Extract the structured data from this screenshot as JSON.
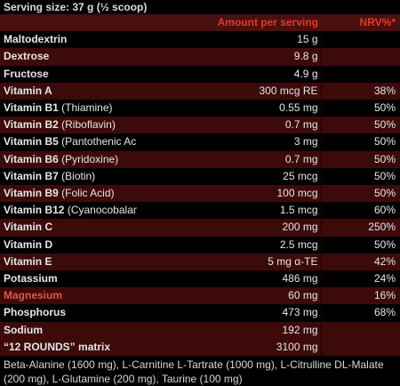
{
  "serving": "Serving size: 37 g (½ scoop)",
  "headers": {
    "name": "",
    "amount": "Amount per serving",
    "nrv": "NRV%*"
  },
  "rows": [
    {
      "name": "Maltodextrin",
      "sub": "",
      "amount": "15 g",
      "nrv": "",
      "style": "dark",
      "accent": false
    },
    {
      "name": "Dextrose",
      "sub": "",
      "amount": "9.8 g",
      "nrv": "",
      "style": "red",
      "accent": false
    },
    {
      "name": "Fructose",
      "sub": "",
      "amount": "4.9 g",
      "nrv": "",
      "style": "dark",
      "accent": false
    },
    {
      "name": "Vitamin A",
      "sub": "",
      "amount": "300 mcg RE",
      "nrv": "38%",
      "style": "red",
      "accent": false
    },
    {
      "name": "Vitamin B1",
      "sub": " (Thiamine)",
      "amount": "0.55 mg",
      "nrv": "50%",
      "style": "dark",
      "accent": false
    },
    {
      "name": "Vitamin B2",
      "sub": " (Riboflavin)",
      "amount": "0.7 mg",
      "nrv": "50%",
      "style": "red",
      "accent": false
    },
    {
      "name": "Vitamin B5",
      "sub": " (Pantothenic Acid)",
      "amount": "3 mg",
      "nrv": "50%",
      "style": "dark",
      "accent": false
    },
    {
      "name": "Vitamin B6",
      "sub": " (Pyridoxine)",
      "amount": "0.7 mg",
      "nrv": "50%",
      "style": "red",
      "accent": false
    },
    {
      "name": "Vitamin B7",
      "sub": " (Biotin)",
      "amount": "25 mcg",
      "nrv": "50%",
      "style": "dark",
      "accent": false
    },
    {
      "name": "Vitamin B9",
      "sub": " (Folic Acid)",
      "amount": "100 mcg",
      "nrv": "50%",
      "style": "red",
      "accent": false
    },
    {
      "name": "Vitamin B12",
      "sub": " (Cyanocobalamin)",
      "amount": "1.5 mcg",
      "nrv": "60%",
      "style": "dark",
      "accent": false
    },
    {
      "name": "Vitamin C",
      "sub": "",
      "amount": "200 mg",
      "nrv": "250%",
      "style": "red",
      "accent": false
    },
    {
      "name": "Vitamin D",
      "sub": "",
      "amount": "2.5 mcg",
      "nrv": "50%",
      "style": "dark",
      "accent": false
    },
    {
      "name": "Vitamin E",
      "sub": "",
      "amount": "5 mg α-TE",
      "nrv": "42%",
      "style": "red",
      "accent": false
    },
    {
      "name": "Potassium",
      "sub": "",
      "amount": "486 mg",
      "nrv": "24%",
      "style": "dark",
      "accent": false
    },
    {
      "name": "Magnesium",
      "sub": "",
      "amount": "60 mg",
      "nrv": "16%",
      "style": "red",
      "accent": true
    },
    {
      "name": "Phosphorus",
      "sub": "",
      "amount": "473 mg",
      "nrv": "68%",
      "style": "dark",
      "accent": false
    },
    {
      "name": "Sodium",
      "sub": "",
      "amount": "192 mg",
      "nrv": "",
      "style": "red",
      "accent": false
    },
    {
      "name": "“12 ROUNDS” matrix",
      "sub": "",
      "amount": "3100 mg",
      "nrv": "",
      "style": "red",
      "accent": false
    }
  ],
  "note": "Beta-Alanine (1600 mg), L-Carnitine L-Tartrate (1000 mg), L-Citrulline DL-Malate (200 mg), L-Glutamine (200 mg), Taurine (100 mg)"
}
